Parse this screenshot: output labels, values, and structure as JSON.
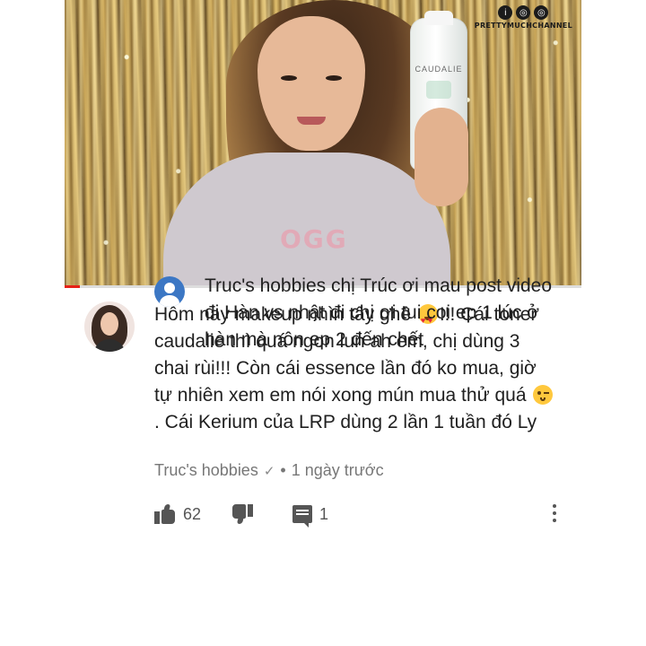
{
  "video": {
    "channel_name": "PRETTYMUCHCHANNEL",
    "channel_icons": [
      "info-icon",
      "camera-icon",
      "camera-icon"
    ],
    "bottle_brand": "CAUDALIE",
    "shirt_text": "OGG",
    "progress": 0.03,
    "accent_color": "#e62117"
  },
  "comment": {
    "text_part1": "Hôm nay makeup nhìn tây ghê ",
    "emoji1": "heart-eyes-emoji",
    "text_part2": "!!! Cái toner caudalie thì quá ngon lun ah em, chị dùng 3 chai rùi!!! Còn cái essence lần đó ko mua, giờ tự nhiên xem em nói xong mún mua thử quá ",
    "emoji2": "winking-emoji",
    "text_part3": ". Cái Kerium của LRP dùng 2 lần 1 tuần đó Ly",
    "author": "Truc's hobbies",
    "check": "✓",
    "separator": "•",
    "time": "1 ngày trước",
    "like_count": "62",
    "reply_count": "1"
  },
  "reply": {
    "author": "Truc's hobbies",
    "text": " chị Trúc ơi mau post video đi Hàn vs nhật đi chị ơi tui coi ep 1 lúc ở hàn mà nôn ep 2 đến chết"
  }
}
